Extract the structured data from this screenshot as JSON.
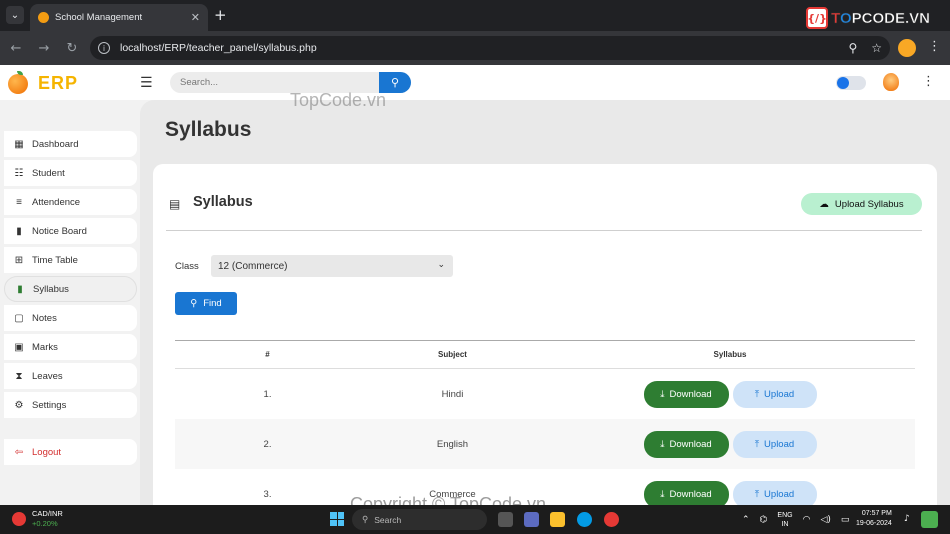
{
  "browser": {
    "tab_title": "School Management",
    "url": "localhost/ERP/teacher_panel/syllabus.php",
    "brand_prefix": "T",
    "brand_o": "O",
    "brand_rest": "PCODE.VN"
  },
  "app": {
    "logo_text": "ERP",
    "search_placeholder": "Search..."
  },
  "sidebar": {
    "items": [
      {
        "label": "Dashboard",
        "icon": "dashboard-icon"
      },
      {
        "label": "Student",
        "icon": "student-icon"
      },
      {
        "label": "Attendence",
        "icon": "attendence-icon"
      },
      {
        "label": "Notice Board",
        "icon": "bookmark-icon"
      },
      {
        "label": "Time Table",
        "icon": "table-icon"
      },
      {
        "label": "Syllabus",
        "icon": "file-icon",
        "active": true
      },
      {
        "label": "Notes",
        "icon": "notes-icon"
      },
      {
        "label": "Marks",
        "icon": "marks-icon"
      },
      {
        "label": "Leaves",
        "icon": "hourglass-icon"
      },
      {
        "label": "Settings",
        "icon": "gear-icon"
      }
    ],
    "logout_label": "Logout"
  },
  "main": {
    "page_title": "Syllabus",
    "card_title": "Syllabus",
    "upload_syllabus_label": "Upload Syllabus",
    "class_label": "Class",
    "class_value": "12 (Commerce)",
    "find_label": "Find",
    "table": {
      "headers": [
        "#",
        "Subject",
        "Syllabus"
      ],
      "rows": [
        {
          "num": "1.",
          "subject": "Hindi"
        },
        {
          "num": "2.",
          "subject": "English"
        },
        {
          "num": "3.",
          "subject": "Commerce"
        }
      ],
      "download_label": "Download",
      "upload_label": "Upload"
    }
  },
  "watermarks": {
    "top": "TopCode.vn",
    "bottom": "Copyright © TopCode.vn"
  },
  "taskbar": {
    "ticker_pair": "CAD/INR",
    "ticker_change": "+0.20%",
    "search_label": "Search",
    "lang_1": "ENG",
    "lang_2": "IN",
    "time": "07:57 PM",
    "date": "19-06-2024"
  },
  "colors": {
    "primary": "#1976d2",
    "download": "#2e7d32",
    "upload_bg": "#cfe3f8",
    "upload_syllabus_bg": "#b9f0d0",
    "logout": "#d32f2f"
  }
}
